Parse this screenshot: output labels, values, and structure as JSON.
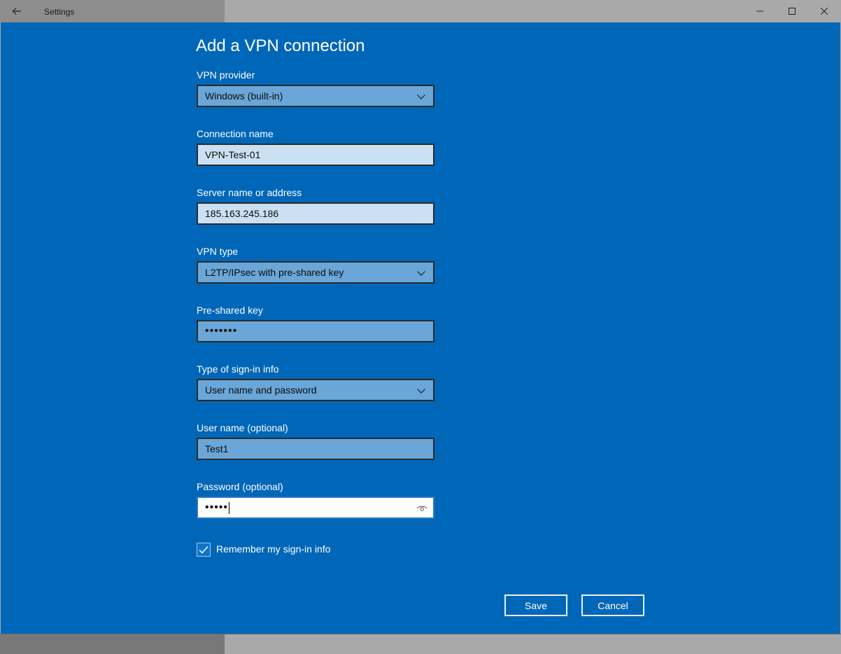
{
  "window": {
    "title": "Settings",
    "back_icon": "back-arrow-icon",
    "minimize_icon": "minimize-icon",
    "maximize_icon": "maximize-icon",
    "close_icon": "close-icon"
  },
  "dialog": {
    "heading": "Add a VPN connection",
    "vpn_provider": {
      "label": "VPN provider",
      "value": "Windows (built-in)"
    },
    "connection_name": {
      "label": "Connection name",
      "value": "VPN-Test-01"
    },
    "server": {
      "label": "Server name or address",
      "value": "185.163.245.186"
    },
    "vpn_type": {
      "label": "VPN type",
      "value": "L2TP/IPsec with pre-shared key"
    },
    "pre_shared_key": {
      "label": "Pre-shared key",
      "value": "•••••••"
    },
    "sign_in_type": {
      "label": "Type of sign-in info",
      "value": "User name and password"
    },
    "user_name": {
      "label": "User name (optional)",
      "value": "Test1"
    },
    "password": {
      "label": "Password (optional)",
      "value": "•••••",
      "reveal_icon": "eye-icon"
    },
    "remember": {
      "label": "Remember my sign-in info",
      "checked": true
    },
    "save_label": "Save",
    "cancel_label": "Cancel"
  },
  "colors": {
    "dialog_background": "#0067b8",
    "field_fill": "#6aa7d8",
    "field_light": "#cbe1f3",
    "text_on_dialog": "#ffffff"
  }
}
